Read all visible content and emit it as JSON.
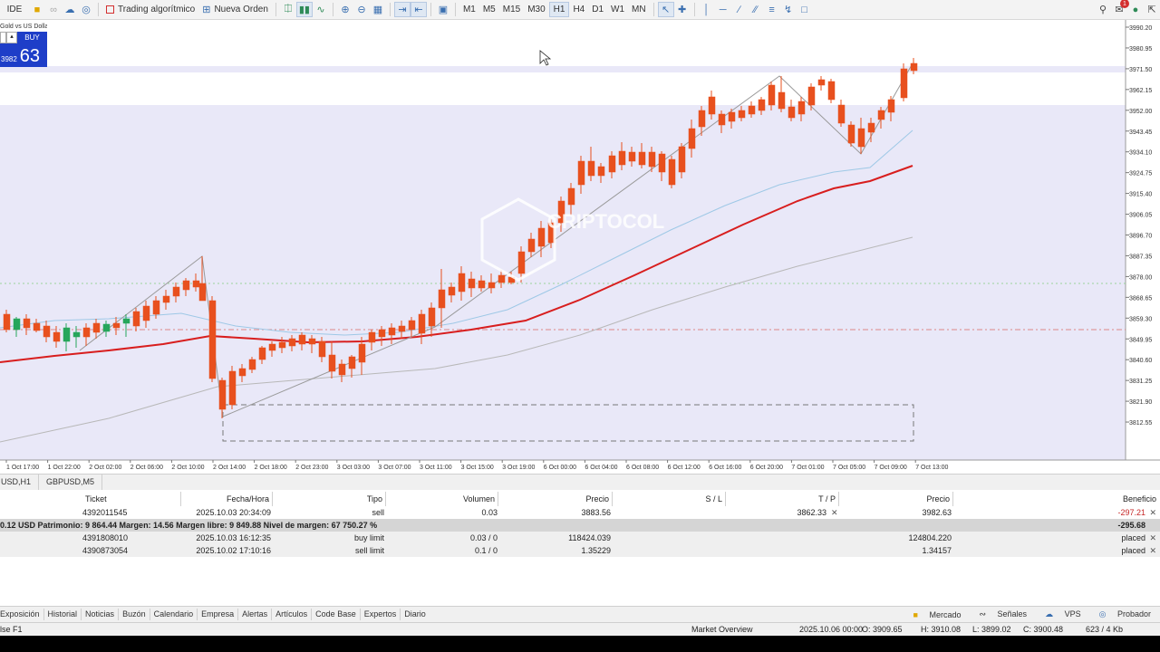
{
  "toolbar": {
    "ide": "IDE",
    "algo_trading": "Trading algorítmico",
    "new_order": "Nueva Orden",
    "timeframes": [
      "M1",
      "M5",
      "M15",
      "M30",
      "H1",
      "H4",
      "D1",
      "W1",
      "MN"
    ],
    "active_timeframe": "H1",
    "notification_count": "1"
  },
  "one_click": {
    "symbol": "Gold vs US Dollar",
    "buy_label": "BUY",
    "price_small": "3982",
    "price_big": "63"
  },
  "chart": {
    "watermark": "CRIPTOCOL",
    "price_labels": [
      "3990.20",
      "3980.95",
      "3971.50",
      "3962.15",
      "3952.00",
      "3943.45",
      "3934.10",
      "3924.75",
      "3915.40",
      "3906.05",
      "3896.70",
      "3887.35",
      "3878.00",
      "3868.65",
      "3859.30",
      "3849.95",
      "3840.60",
      "3831.25",
      "3821.90",
      "3812.55"
    ],
    "time_labels": [
      "1 Oct 17:00",
      "1 Oct 22:00",
      "2 Oct 02:00",
      "2 Oct 06:00",
      "2 Oct 10:00",
      "2 Oct 14:00",
      "2 Oct 18:00",
      "2 Oct 23:00",
      "3 Oct 03:00",
      "3 Oct 07:00",
      "3 Oct 11:00",
      "3 Oct 15:00",
      "3 Oct 19:00",
      "6 Oct 00:00",
      "6 Oct 04:00",
      "6 Oct 08:00",
      "6 Oct 12:00",
      "6 Oct 16:00",
      "6 Oct 20:00",
      "7 Oct 01:00",
      "7 Oct 05:00",
      "7 Oct 09:00",
      "7 Oct 13:00"
    ],
    "colors": {
      "bull": "#26a65b",
      "bear": "#e8501e",
      "ma_red": "#d81e1e",
      "ma_blue": "#9ec8e6",
      "ma_gray": "#b8b8b8",
      "bg_zone": "#e9e8f8"
    }
  },
  "chart_tabs": [
    "USD,H1",
    "GBPUSD,M5"
  ],
  "trade": {
    "headers": [
      "Ticket",
      "Fecha/Hora",
      "Tipo",
      "Volumen",
      "Precio",
      "S / L",
      "T / P",
      "Precio",
      "Beneficio"
    ],
    "position": {
      "ticket": "4392011545",
      "time": "2025.10.03 20:34:09",
      "type": "sell",
      "volume": "0.03",
      "price": "3883.56",
      "sl": "",
      "tp": "3862.33",
      "current": "3982.63",
      "profit": "-297.21"
    },
    "summary": {
      "text": "0.12 USD  Patrimonio: 9 864.44  Margen: 14.56  Margen libre: 9 849.88  Nivel de margen: 67 750.27 %",
      "profit": "-295.68"
    },
    "orders": [
      {
        "ticket": "4391808010",
        "time": "2025.10.03 16:12:35",
        "type": "buy limit",
        "volume": "0.03 / 0",
        "price": "118424.039",
        "current": "124804.220",
        "state": "placed"
      },
      {
        "ticket": "4390873054",
        "time": "2025.10.02 17:10:16",
        "type": "sell limit",
        "volume": "0.1 / 0",
        "price": "1.35229",
        "current": "1.34157",
        "state": "placed"
      }
    ]
  },
  "bottom_tabs": [
    "Exposición",
    "Historial",
    "Noticias",
    "Buzón",
    "Calendario",
    "Empresa",
    "Alertas",
    "Artículos",
    "Code Base",
    "Expertos",
    "Diario"
  ],
  "bottom_right": {
    "market": "Mercado",
    "signals": "Señales",
    "vps": "VPS",
    "tester": "Probador"
  },
  "status": {
    "help": "lse F1",
    "market_overview": "Market Overview",
    "datetime": "2025.10.06 00:00",
    "open": "O: 3909.65",
    "high": "H: 3910.08",
    "low": "L: 3899.02",
    "close": "C: 3900.48",
    "traffic": "623 / 4 Kb"
  }
}
